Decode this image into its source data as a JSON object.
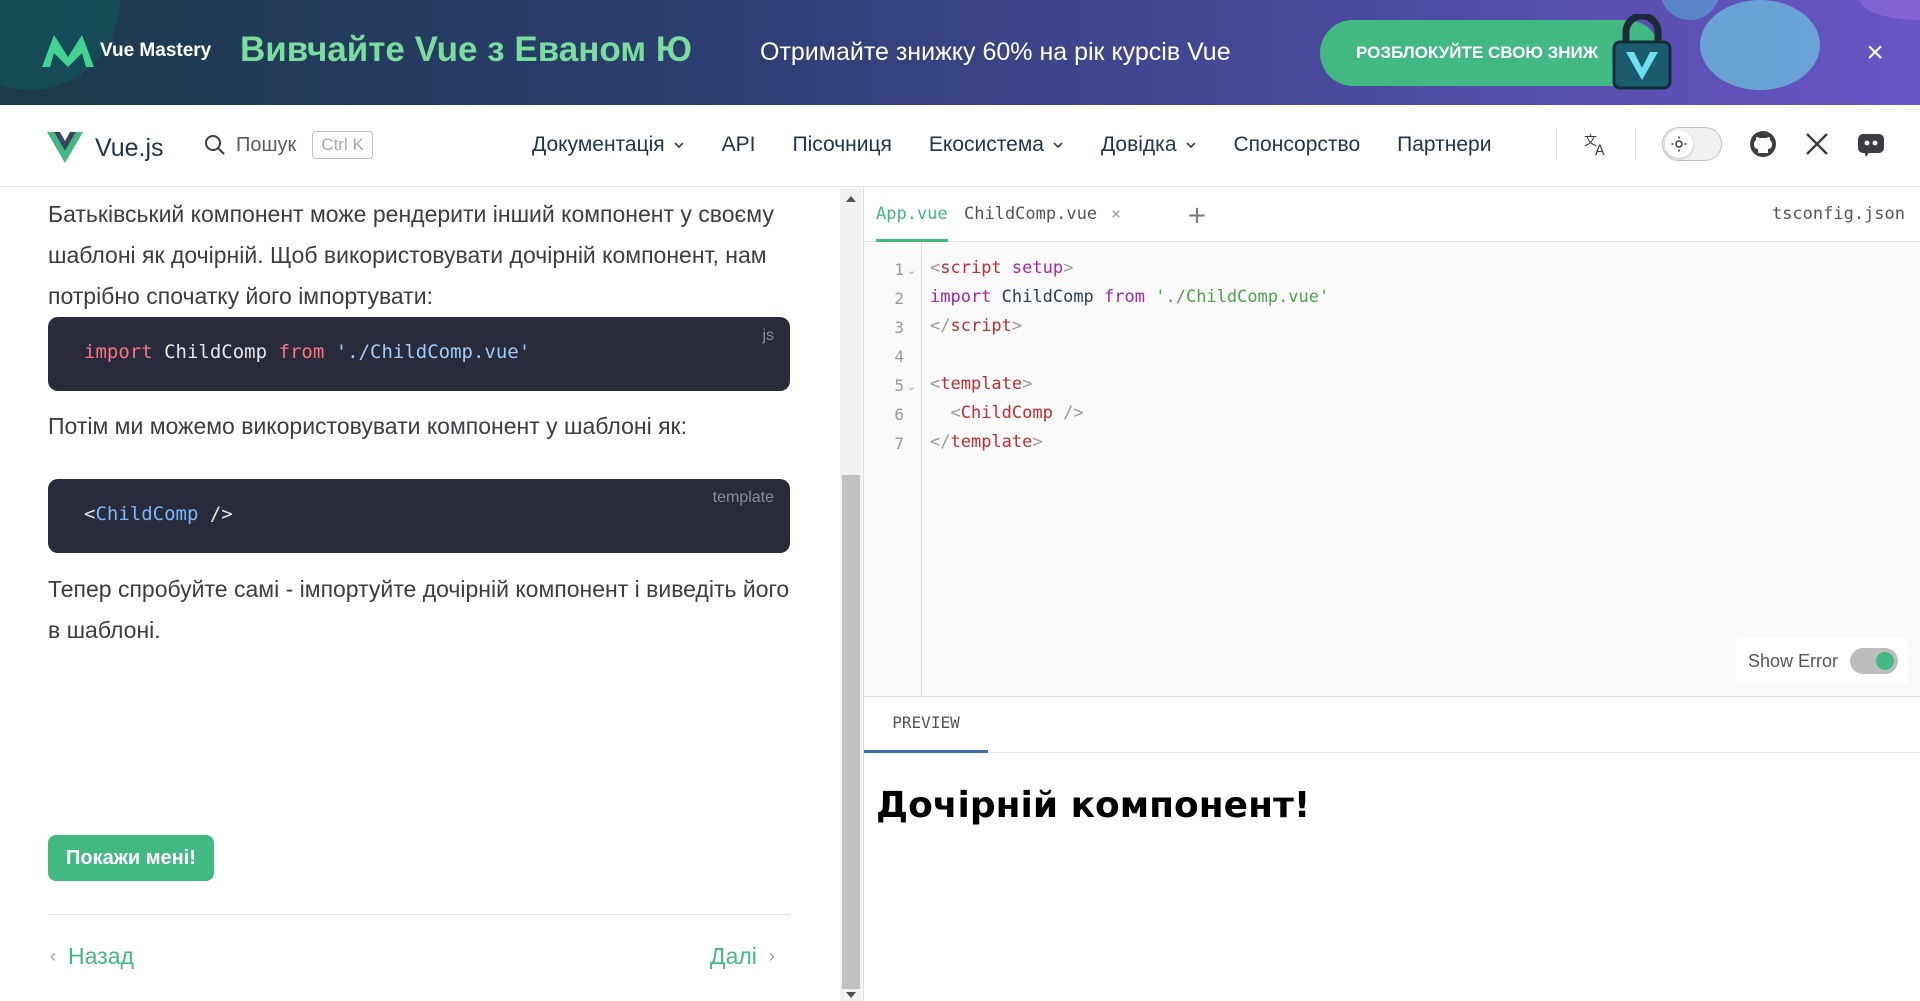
{
  "banner": {
    "logo_text": "Vue Mastery",
    "title": "Вивчайте Vue з Еваном Ю",
    "subtitle": "Отримайте знижку 60% на рік курсів Vue",
    "cta": "РОЗБЛОКУЙТЕ СВОЮ ЗНИЖ",
    "close": "×"
  },
  "header": {
    "brand": "Vue.js",
    "search_label": "Пошук",
    "search_kbd": "Ctrl K",
    "nav": [
      {
        "label": "Документація",
        "has_dropdown": true
      },
      {
        "label": "API",
        "has_dropdown": false
      },
      {
        "label": "Пісочниця",
        "has_dropdown": false
      },
      {
        "label": "Екосистема",
        "has_dropdown": true
      },
      {
        "label": "Довідка",
        "has_dropdown": true
      },
      {
        "label": "Спонсорство",
        "has_dropdown": false
      },
      {
        "label": "Партнери",
        "has_dropdown": false
      }
    ]
  },
  "tutorial": {
    "para1": "Батьківський компонент може рендерити інший компонент у своєму шаблоні як дочірній. Щоб використовувати дочірній компонент, нам потрібно спочатку його імпортувати:",
    "code1": {
      "lang": "js",
      "kw_import": "import",
      "name": "ChildComp",
      "kw_from": "from",
      "path": "'./ChildComp.vue'"
    },
    "para2": "Потім ми можемо використовувати компонент у шаблоні як:",
    "code2": {
      "lang": "template",
      "open": "<",
      "tag": "ChildComp",
      "close": " />"
    },
    "para3": "Тепер спробуйте самі - імпортуйте дочірній компонент і виведіть його в шаблоні.",
    "show_button": "Покажи мені!",
    "prev": "Назад",
    "next": "Далі"
  },
  "editor": {
    "tabs": [
      {
        "label": "App.vue",
        "active": true
      },
      {
        "label": "ChildComp.vue",
        "active": false
      }
    ],
    "close_symbol": "×",
    "add_symbol": "+",
    "tsconfig": "tsconfig.json",
    "line_numbers": [
      "1",
      "2",
      "3",
      "4",
      "5",
      "6",
      "7"
    ],
    "lines": {
      "l1_tag": "script",
      "l1_attr": "setup",
      "l2_import": "import",
      "l2_name": "ChildComp",
      "l2_from": "from",
      "l2_path": "'./ChildComp.vue'",
      "l3_tag": "script",
      "l5_tag": "template",
      "l6_tag": "ChildComp",
      "l7_tag": "template"
    },
    "show_error_label": "Show Error",
    "show_error_on": true
  },
  "preview": {
    "tab": "PREVIEW",
    "heading": "Дочірній компонент!"
  },
  "colors": {
    "accent": "#42b883",
    "code_bg": "#292b3b"
  }
}
